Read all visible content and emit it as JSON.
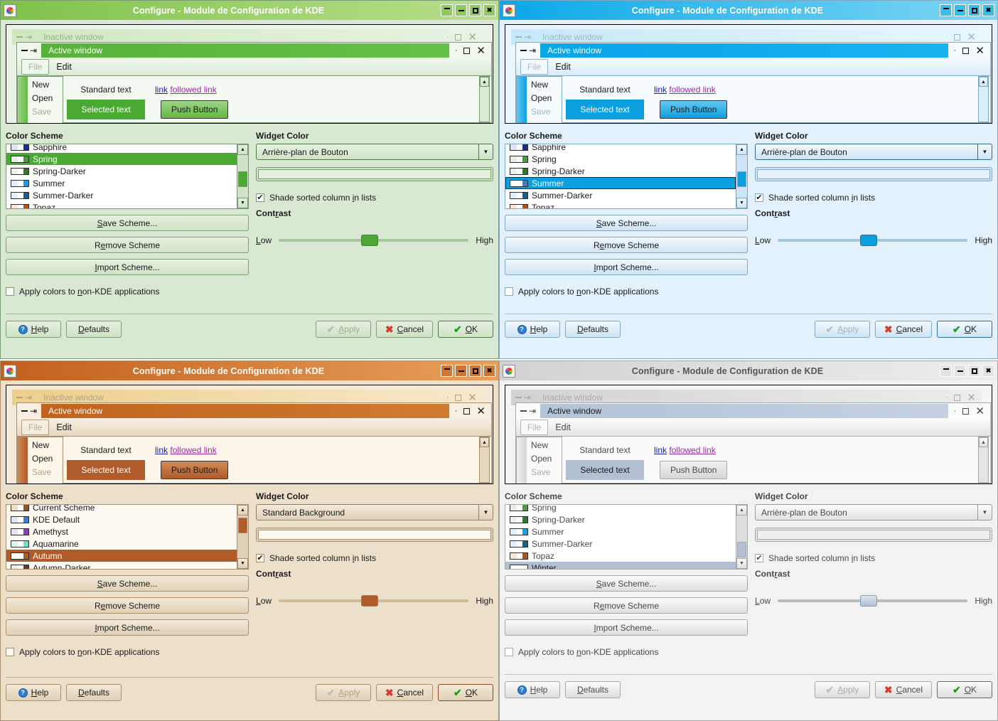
{
  "window_title": "Configure - Module de Configuration de KDE",
  "titlebar_buttons": [
    "shade",
    "minimize",
    "maximize",
    "close"
  ],
  "preview": {
    "inactive_title": "Inactive window",
    "active_title": "Active window",
    "menu_file": "File",
    "menu_edit": "Edit",
    "menu_items": [
      "New",
      "Open",
      "Save"
    ],
    "standard_text": "Standard text",
    "link": "link",
    "followed_link": "followed link",
    "selected_text": "Selected text",
    "push_button": "Push Button"
  },
  "left_panel": {
    "group_title": "Color Scheme",
    "save_label": "Save Scheme...",
    "remove_label": "Remove Scheme",
    "import_label": "Import Scheme...",
    "apply_nonkde_label": "Apply colors to non-KDE applications",
    "apply_nonkde_checked": false
  },
  "right_panel": {
    "group_title": "Widget Color",
    "shade_label": "Shade sorted column in lists",
    "shade_checked": true,
    "contrast_label": "Contrast",
    "low_label": "Low",
    "high_label": "High"
  },
  "buttons": {
    "help": "Help",
    "defaults": "Defaults",
    "apply": "Apply",
    "cancel": "Cancel",
    "ok": "OK"
  },
  "windows": [
    {
      "id": "spring",
      "selected_scheme": "Spring",
      "widget_color_value": "Arrière-plan de Bouton",
      "contrast_percent": 48,
      "active": true,
      "list": [
        {
          "label": "Sapphire",
          "a": "#dfe3f5",
          "b": "#ffffff",
          "c": "#1b2e8f"
        },
        {
          "label": "Spring",
          "a": "#e8f0e4",
          "b": "#ffffff",
          "c": "#4a9e3a"
        },
        {
          "label": "Spring-Darker",
          "a": "#eef2e8",
          "b": "#ffffff",
          "c": "#2f7a28"
        },
        {
          "label": "Summer",
          "a": "#e4f0fb",
          "b": "#ffffff",
          "c": "#14a0e8"
        },
        {
          "label": "Summer-Darker",
          "a": "#e4f0fb",
          "b": "#ffffff",
          "c": "#16608f"
        },
        {
          "label": "Topaz",
          "a": "#f7e8d8",
          "b": "#ffffff",
          "c": "#b0541a"
        }
      ],
      "colors": {
        "title_bar_start": "#7ec24a",
        "title_bar_end": "#b9e08c",
        "title_text": "#ffffff",
        "title_btn_bg": "#8fcb5e",
        "window_bg": "#d9e8d2",
        "panel_bg": "#d9e8d2",
        "text": "#1a1a1a",
        "accent": "#4aa833",
        "accent_text": "#ffffff",
        "frame": "#7a9a72",
        "button_bg_start": "#e6f0e0",
        "button_bg_end": "#cfe3c6",
        "button_border": "#7fa176",
        "list_bg": "#ffffff",
        "preview_bg": "#eaf4e6",
        "preview_inner_bg": "#f4faf2",
        "preview_titlebar_active_start": "#58b23a",
        "preview_titlebar_active_end": "#66c246",
        "preview_titlebar_inactive_start": "#cfe8c0",
        "preview_titlebar_inactive_end": "#e9f4e3",
        "preview_menubar_start": "#f0f8ee",
        "preview_menubar_end": "#dbead4",
        "push_bg_start": "#9ed487",
        "push_bg_end": "#63b844",
        "link": "#1a1aa8",
        "vlink": "#9b29a8",
        "disabled": "#9bb093",
        "combo_bg_start": "#e8f2e2",
        "combo_bg_end": "#cfe3c6",
        "combo_border": "#4d7a3f",
        "field_inner": "#e4efdd",
        "slider_track": "#a8c69c",
        "hr": "#a8bda0"
      }
    },
    {
      "id": "summer",
      "selected_scheme": "Summer",
      "widget_color_value": "Arrière-plan de Bouton",
      "contrast_percent": 48,
      "active": true,
      "list": [
        {
          "label": "Sapphire",
          "a": "#dfe3f5",
          "b": "#ffffff",
          "c": "#1b2e8f"
        },
        {
          "label": "Spring",
          "a": "#e8f0e4",
          "b": "#ffffff",
          "c": "#4a9e3a"
        },
        {
          "label": "Spring-Darker",
          "a": "#eef2e8",
          "b": "#ffffff",
          "c": "#2f7a28"
        },
        {
          "label": "Summer",
          "a": "#ffffff",
          "b": "#ffffff",
          "c": "#3a7fc0"
        },
        {
          "label": "Summer-Darker",
          "a": "#e4f0fb",
          "b": "#ffffff",
          "c": "#16608f"
        },
        {
          "label": "Topaz",
          "a": "#f7e8d8",
          "b": "#ffffff",
          "c": "#b0541a"
        }
      ],
      "colors": {
        "title_bar_start": "#0aa8e8",
        "title_bar_end": "#7fd6f4",
        "title_text": "#ffffff",
        "title_btn_bg": "#38bdef",
        "window_bg": "#e2f1fb",
        "panel_bg": "#e2f1fb",
        "text": "#1a1a1a",
        "accent": "#0b9fe0",
        "accent_text": "#ffffff",
        "frame": "#7fa8c2",
        "button_bg_start": "#f2f9fe",
        "button_bg_end": "#cfe4f4",
        "button_border": "#7fa8c2",
        "list_bg": "#ffffff",
        "preview_bg": "#eaf6fd",
        "preview_inner_bg": "#f6fbff",
        "preview_titlebar_active_start": "#07a6e9",
        "preview_titlebar_active_end": "#18b2f0",
        "preview_titlebar_inactive_start": "#c6e9fa",
        "preview_titlebar_inactive_end": "#e8f6fd",
        "preview_menubar_start": "#f4fbff",
        "preview_menubar_end": "#d9ecf8",
        "push_bg_start": "#63c8f0",
        "push_bg_end": "#0d9fe0",
        "link": "#1a1aa8",
        "vlink": "#9b29a8",
        "disabled": "#9fb6c4",
        "combo_bg_start": "#f2f9fe",
        "combo_bg_end": "#cfe4f4",
        "combo_border": "#2e6d93",
        "field_inner": "#e6f2fa",
        "slider_track": "#a6c8dc",
        "hr": "#a8c2d4"
      }
    },
    {
      "id": "autumn",
      "selected_scheme": "Autumn",
      "widget_color_value": "Standard Background",
      "contrast_percent": 48,
      "active": true,
      "list": [
        {
          "label": "Current Scheme",
          "a": "#f0ddc8",
          "b": "#ffffff",
          "c": "#9c4f1e"
        },
        {
          "label": "KDE Default",
          "a": "#dfe9f5",
          "b": "#ffffff",
          "c": "#3a80d0"
        },
        {
          "label": "Amethyst",
          "a": "#ece0f5",
          "b": "#ffffff",
          "c": "#8a3fc0"
        },
        {
          "label": "Aquamarine",
          "a": "#ddf5ef",
          "b": "#ffffff",
          "c": "#6fe3c0"
        },
        {
          "label": "Autumn",
          "a": "#ffffff",
          "b": "#ffffff",
          "c": "#b05a28"
        },
        {
          "label": "Autumn-Darker",
          "a": "#f5ece0",
          "b": "#ffffff",
          "c": "#6b3a1c"
        }
      ],
      "colors": {
        "title_bar_start": "#c1601e",
        "title_bar_end": "#e8a05c",
        "title_text": "#ffffff",
        "title_btn_bg": "#cf7634",
        "window_bg": "#ece0cb",
        "panel_bg": "#ece0cb",
        "text": "#1a1a1a",
        "accent": "#b05c2a",
        "accent_text": "#ffffff",
        "frame": "#ab8f6c",
        "button_bg_start": "#f3ead9",
        "button_bg_end": "#e0d0b6",
        "button_border": "#ab8f6c",
        "list_bg": "#fdf8f0",
        "preview_bg": "#f3ead9",
        "preview_inner_bg": "#fbf5ea",
        "preview_titlebar_active_start": "#c0631f",
        "preview_titlebar_active_end": "#cf7a33",
        "preview_titlebar_inactive_start": "#edcf8c",
        "preview_titlebar_inactive_end": "#f7e9cc",
        "preview_menubar_start": "#f6efe2",
        "preview_menubar_end": "#e6d8bd",
        "push_bg_start": "#d08a55",
        "push_bg_end": "#b05c2a",
        "link": "#1a1aa8",
        "vlink": "#9b29a8",
        "disabled": "#b3a189",
        "combo_bg_start": "#f3ead9",
        "combo_bg_end": "#e0d0b6",
        "combo_border": "#9a7b54",
        "field_inner": "#fdf8f0",
        "slider_track": "#d3bb98",
        "hr": "#c4ad8c"
      }
    },
    {
      "id": "winter",
      "selected_scheme": "Winter",
      "widget_color_value": "Arrière-plan de Bouton",
      "contrast_percent": 48,
      "active": false,
      "list": [
        {
          "label": "Spring",
          "a": "#e8f0e4",
          "b": "#ffffff",
          "c": "#4a9e3a"
        },
        {
          "label": "Spring-Darker",
          "a": "#eef2e8",
          "b": "#ffffff",
          "c": "#2f7a28"
        },
        {
          "label": "Summer",
          "a": "#e4f0fb",
          "b": "#ffffff",
          "c": "#14a0e8"
        },
        {
          "label": "Summer-Darker",
          "a": "#e4f0fb",
          "b": "#ffffff",
          "c": "#16608f"
        },
        {
          "label": "Topaz",
          "a": "#f7e8d8",
          "b": "#ffffff",
          "c": "#b0541a"
        },
        {
          "label": "Winter",
          "a": "#ffffff",
          "b": "#ffffff",
          "c": "#ffffff"
        }
      ],
      "colors": {
        "title_bar_start": "#d2d2d2",
        "title_bar_end": "#ededed",
        "title_text": "#555555",
        "title_btn_bg": "#e2e2e2",
        "window_bg": "#f2f2f2",
        "panel_bg": "#f2f2f2",
        "text": "#4a4a4a",
        "accent": "#b3c0d4",
        "accent_text": "#1a1a1a",
        "frame": "#a8a8a8",
        "button_bg_start": "#fbfbfb",
        "button_bg_end": "#dedede",
        "button_border": "#a8a8a8",
        "list_bg": "#ffffff",
        "preview_bg": "#f4f4f4",
        "preview_inner_bg": "#fafafa",
        "preview_titlebar_active_start": "#b5c3d8",
        "preview_titlebar_active_end": "#c5d1e2",
        "preview_titlebar_inactive_start": "#d2d2d2",
        "preview_titlebar_inactive_end": "#ededed",
        "preview_menubar_start": "#fbfbfb",
        "preview_menubar_end": "#e4e4e4",
        "push_bg_start": "#f0f0f0",
        "push_bg_end": "#d6d6d6",
        "link": "#1a1aa8",
        "vlink": "#9b29a8",
        "disabled": "#aaaaaa",
        "combo_bg_start": "#fbfbfb",
        "combo_bg_end": "#e2e2e2",
        "combo_border": "#9a9a9a",
        "field_inner": "#efefef",
        "slider_track": "#bdbdbd",
        "hr": "#c8c8c8"
      }
    }
  ]
}
